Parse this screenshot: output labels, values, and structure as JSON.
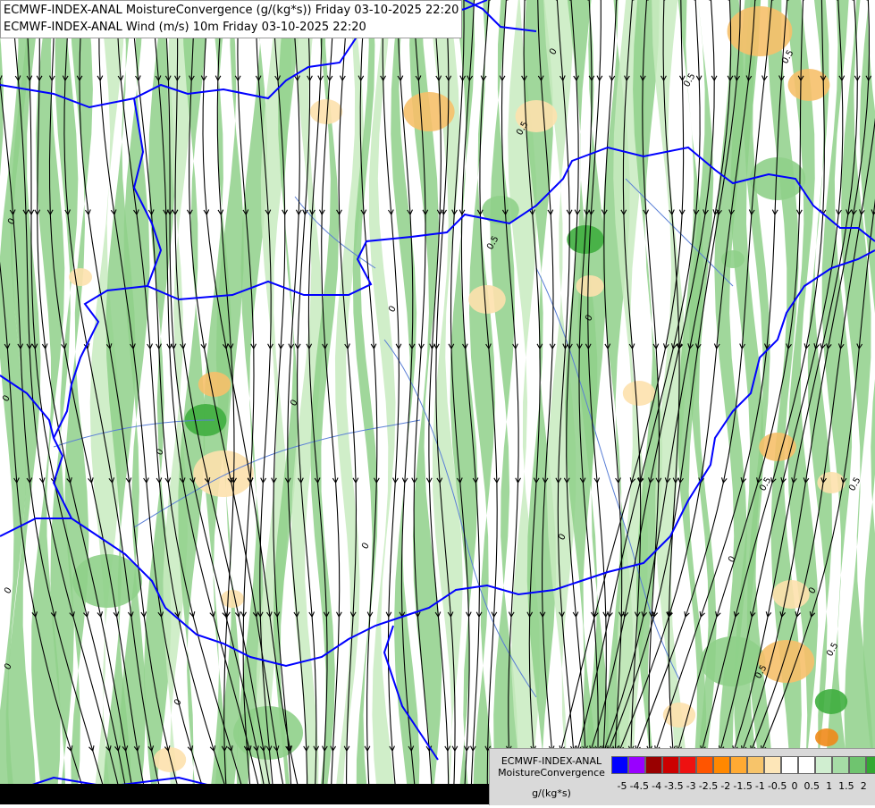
{
  "titles": {
    "line1": "ECMWF-INDEX-ANAL MoistureConvergence (g/(kg*s)) Friday 03-10-2025 22:20",
    "line2": "ECMWF-INDEX-ANAL Wind (m/s) 10m Friday 03-10-2025 22:20"
  },
  "legend": {
    "title_line1": "ECMWF-INDEX-ANAL",
    "title_line2": "MoistureConvergence",
    "unit": "g/(kg*s)",
    "colors": [
      "#0000ff",
      "#9900ff",
      "#990000",
      "#cc0000",
      "#ee1111",
      "#ff5500",
      "#ff8800",
      "#ffaa33",
      "#f7c46a",
      "#fde6b8",
      "#ffffff",
      "#ffffff",
      "#d0eed0",
      "#a6dca6",
      "#6fc46f",
      "#33a833",
      "#009900"
    ],
    "tick_labels": [
      "-5",
      "-4.5",
      "-4",
      "-3.5",
      "-3",
      "-2.5",
      "-2",
      "-1.5",
      "-1",
      "-0.5",
      "0",
      "0.5",
      "1",
      "1.5",
      "2"
    ]
  },
  "map": {
    "contour_label": "0",
    "contour_label_alt": "0.5",
    "colors": {
      "green_light": "#c8ebc0",
      "green_mid": "#8fd08a",
      "green_dark": "#3fae3f",
      "orange_light": "#fde1ad",
      "orange_mid": "#f6c06a",
      "orange_dark": "#f08a1a",
      "border": "#0000ff",
      "river": "#5a7fd6",
      "streamline": "#000000",
      "contour": "#222222"
    }
  }
}
